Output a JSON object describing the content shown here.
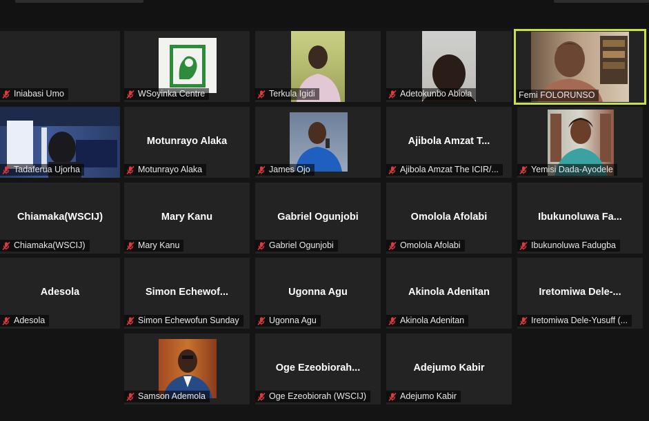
{
  "colors": {
    "background": "#141414",
    "tile": "#232323",
    "active_speaker_border": "#c6e24a",
    "muted_icon": "#e0393e",
    "name_text": "#ffffff"
  },
  "icons": {
    "muted": "mic-muted-icon"
  },
  "participants": [
    {
      "label": "Iniabasi Umo",
      "muted": true
    },
    {
      "label": "WSoyinka Centre",
      "muted": true,
      "video": true
    },
    {
      "label": "Terkula Igidi",
      "muted": true,
      "video": true
    },
    {
      "label": "Adetokunbo Abiola",
      "muted": true,
      "video": true
    },
    {
      "label": "Femi FOLORUNSO",
      "muted": false,
      "video": true,
      "active_speaker": true
    },
    {
      "label": "Tadaferua Ujorha",
      "muted": true,
      "video": true
    },
    {
      "name": "Motunrayo Alaka",
      "label": "Motunrayo Alaka",
      "muted": true
    },
    {
      "label": "James Ojo",
      "muted": true,
      "video": true
    },
    {
      "name": "Ajibola Amzat T...",
      "label": "Ajibola Amzat The ICIR/...",
      "muted": true
    },
    {
      "label": "Yemisi Dada-Ayodele",
      "muted": true,
      "video": true
    },
    {
      "name": "Chiamaka(WSCIJ)",
      "label": "Chiamaka(WSCIJ)",
      "muted": true
    },
    {
      "name": "Mary Kanu",
      "label": "Mary Kanu",
      "muted": true
    },
    {
      "name": "Gabriel Ogunjobi",
      "label": "Gabriel Ogunjobi",
      "muted": true
    },
    {
      "name": "Omolola Afolabi",
      "label": "Omolola Afolabi",
      "muted": true
    },
    {
      "name": "Ibukunoluwa  Fa...",
      "label": "Ibukunoluwa Fadugba",
      "muted": true
    },
    {
      "name": "Adesola",
      "label": "Adesola",
      "muted": true
    },
    {
      "name": "Simon  Echewof...",
      "label": "Simon Echewofun Sunday",
      "muted": true
    },
    {
      "name": "Ugonna Agu",
      "label": "Ugonna Agu",
      "muted": true
    },
    {
      "name": "Akinola Adenitan",
      "label": "Akinola Adenitan",
      "muted": true
    },
    {
      "name": "Iretomiwa  Dele-...",
      "label": "Iretomiwa Dele-Yusuff (...",
      "muted": true
    },
    {
      "label": "Samson Ademola",
      "muted": true,
      "video": true
    },
    {
      "name": "Oge  Ezeobiorah...",
      "label": "Oge Ezeobiorah (WSCIJ)",
      "muted": true
    },
    {
      "name": "Adejumo Kabir",
      "label": "Adejumo Kabir",
      "muted": true
    }
  ]
}
